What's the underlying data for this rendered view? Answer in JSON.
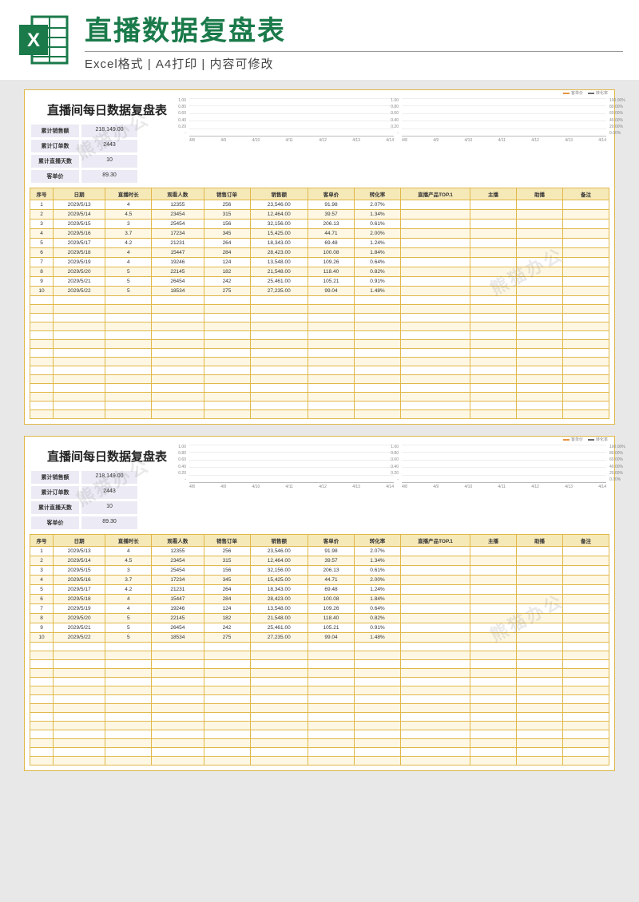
{
  "banner": {
    "title": "直播数据复盘表",
    "subtitle": "Excel格式 | A4打印 | 内容可修改",
    "icon_name": "excel-icon"
  },
  "sheet": {
    "title": "直播间每日数据复盘表",
    "summary": {
      "labels": {
        "total_sales": "累计销售额",
        "total_orders": "累计订单数",
        "total_days": "累计直播天数",
        "unit_price": "客单价"
      },
      "values": {
        "total_sales": "218,149.00",
        "total_orders": "2443",
        "total_days": "10",
        "unit_price": "89.30"
      }
    },
    "columns": [
      "序号",
      "日期",
      "直播时长",
      "观看人数",
      "销售订单",
      "销售额",
      "客单价",
      "转化率",
      "直播产品TOP.1",
      "主播",
      "助播",
      "备注"
    ],
    "rows": [
      {
        "idx": "1",
        "date": "2029/5/13",
        "dur": "4",
        "view": "12355",
        "ord": "256",
        "sales": "23,546.00",
        "unit": "91.98",
        "conv": "2.07%"
      },
      {
        "idx": "2",
        "date": "2029/5/14",
        "dur": "4.5",
        "view": "23454",
        "ord": "315",
        "sales": "12,464.00",
        "unit": "39.57",
        "conv": "1.34%"
      },
      {
        "idx": "3",
        "date": "2029/5/15",
        "dur": "3",
        "view": "25454",
        "ord": "156",
        "sales": "32,156.00",
        "unit": "206.13",
        "conv": "0.61%"
      },
      {
        "idx": "4",
        "date": "2029/5/16",
        "dur": "3.7",
        "view": "17234",
        "ord": "345",
        "sales": "15,425.00",
        "unit": "44.71",
        "conv": "2.00%"
      },
      {
        "idx": "5",
        "date": "2029/5/17",
        "dur": "4.2",
        "view": "21231",
        "ord": "264",
        "sales": "18,343.00",
        "unit": "69.48",
        "conv": "1.24%"
      },
      {
        "idx": "6",
        "date": "2029/5/18",
        "dur": "4",
        "view": "15447",
        "ord": "284",
        "sales": "28,423.00",
        "unit": "100.08",
        "conv": "1.84%"
      },
      {
        "idx": "7",
        "date": "2029/5/19",
        "dur": "4",
        "view": "19246",
        "ord": "124",
        "sales": "13,548.00",
        "unit": "109.26",
        "conv": "0.64%"
      },
      {
        "idx": "8",
        "date": "2029/5/20",
        "dur": "5",
        "view": "22145",
        "ord": "182",
        "sales": "21,548.00",
        "unit": "118.40",
        "conv": "0.82%"
      },
      {
        "idx": "9",
        "date": "2029/5/21",
        "dur": "5",
        "view": "26454",
        "ord": "242",
        "sales": "25,461.00",
        "unit": "105.21",
        "conv": "0.91%"
      },
      {
        "idx": "10",
        "date": "2029/5/22",
        "dur": "5",
        "view": "18534",
        "ord": "275",
        "sales": "27,235.00",
        "unit": "99.04",
        "conv": "1.48%"
      }
    ],
    "empty_rows": 14
  },
  "chart_data": [
    {
      "type": "line",
      "title": "",
      "xlabel": "",
      "ylabel": "",
      "ylim": [
        0,
        1.0
      ],
      "y_ticks": [
        "1.00",
        "0.80",
        "0.60",
        "0.40",
        "0.20",
        "-"
      ],
      "x_ticks": [
        "4/8",
        "4/9",
        "4/10",
        "4/11",
        "4/12",
        "4/13",
        "4/14"
      ],
      "series": []
    },
    {
      "type": "line",
      "title": "",
      "xlabel": "",
      "ylabel": "",
      "ylim_left": [
        0,
        1.0
      ],
      "ylim_right": [
        "0.00%",
        "100.00%"
      ],
      "y_ticks_left": [
        "1.00",
        "0.80",
        "0.60",
        "0.40",
        "0.20",
        "-"
      ],
      "y_ticks_right": [
        "100.00%",
        "80.00%",
        "60.00%",
        "40.00%",
        "20.00%",
        "0.00%"
      ],
      "x_ticks": [
        "4/8",
        "4/9",
        "4/10",
        "4/11",
        "4/12",
        "4/13",
        "4/14"
      ],
      "legend": [
        {
          "name": "客单价",
          "color": "#e8953f"
        },
        {
          "name": "转化率",
          "color": "#6a6a6a"
        }
      ],
      "series": []
    }
  ],
  "watermark": "熊猫办公"
}
